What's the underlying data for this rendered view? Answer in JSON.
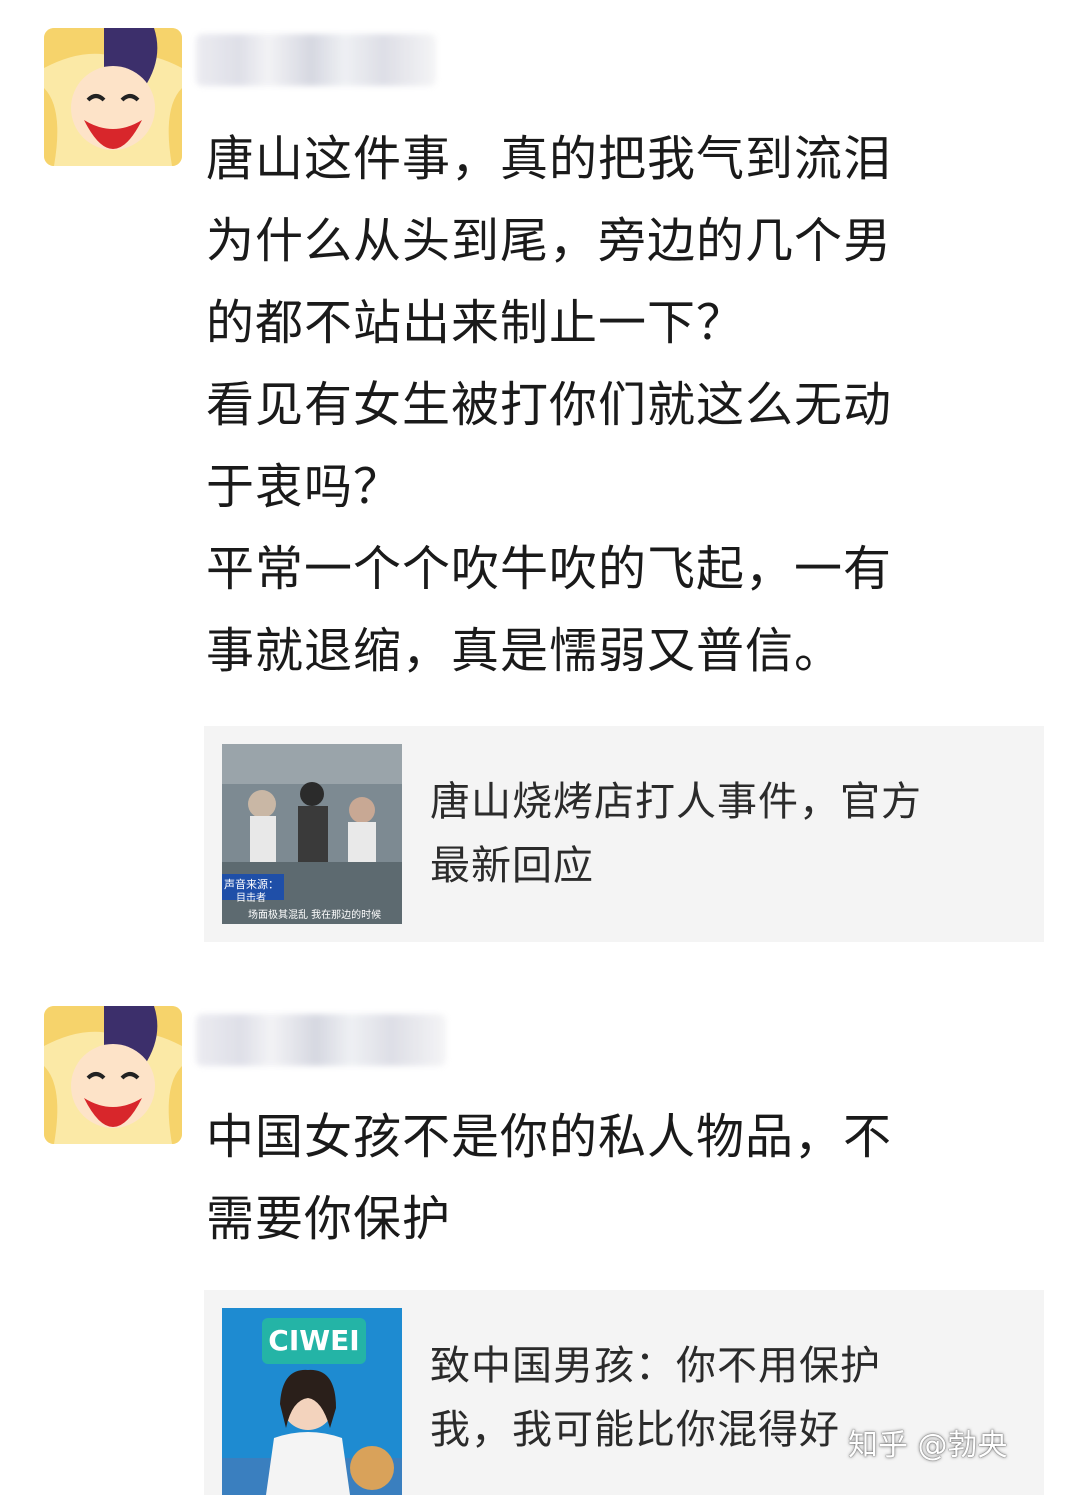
{
  "posts": [
    {
      "lines": [
        "唐山这件事，真的把我气到流泪",
        "为什么从头到尾，旁边的几个男",
        "的都不站出来制止一下？",
        "看见有女生被打你们就这么无动",
        "于衷吗？",
        "平常一个个吹牛吹的飞起，一有",
        "事就退缩，真是懦弱又普信。"
      ],
      "card": {
        "title_lines": [
          "唐山烧烤店打人事件，官方",
          "最新回应"
        ],
        "thumb_caption_top": "声音来源：",
        "thumb_caption_sub": "目击者",
        "thumb_subtitle": "场面极其混乱 我在那边的时候"
      }
    },
    {
      "lines": [
        "中国女孩不是你的私人物品，不",
        "需要你保护"
      ],
      "card": {
        "title_lines": [
          "致中国男孩：你不用保护",
          "我，我可能比你混得好"
        ],
        "thumb_badge": "CIWEI"
      }
    }
  ],
  "watermark": "知乎 @勃央",
  "colors": {
    "card_bg": "#f4f4f4",
    "text": "#1a1a1a",
    "avatar_bg": "#fbe9a6"
  }
}
